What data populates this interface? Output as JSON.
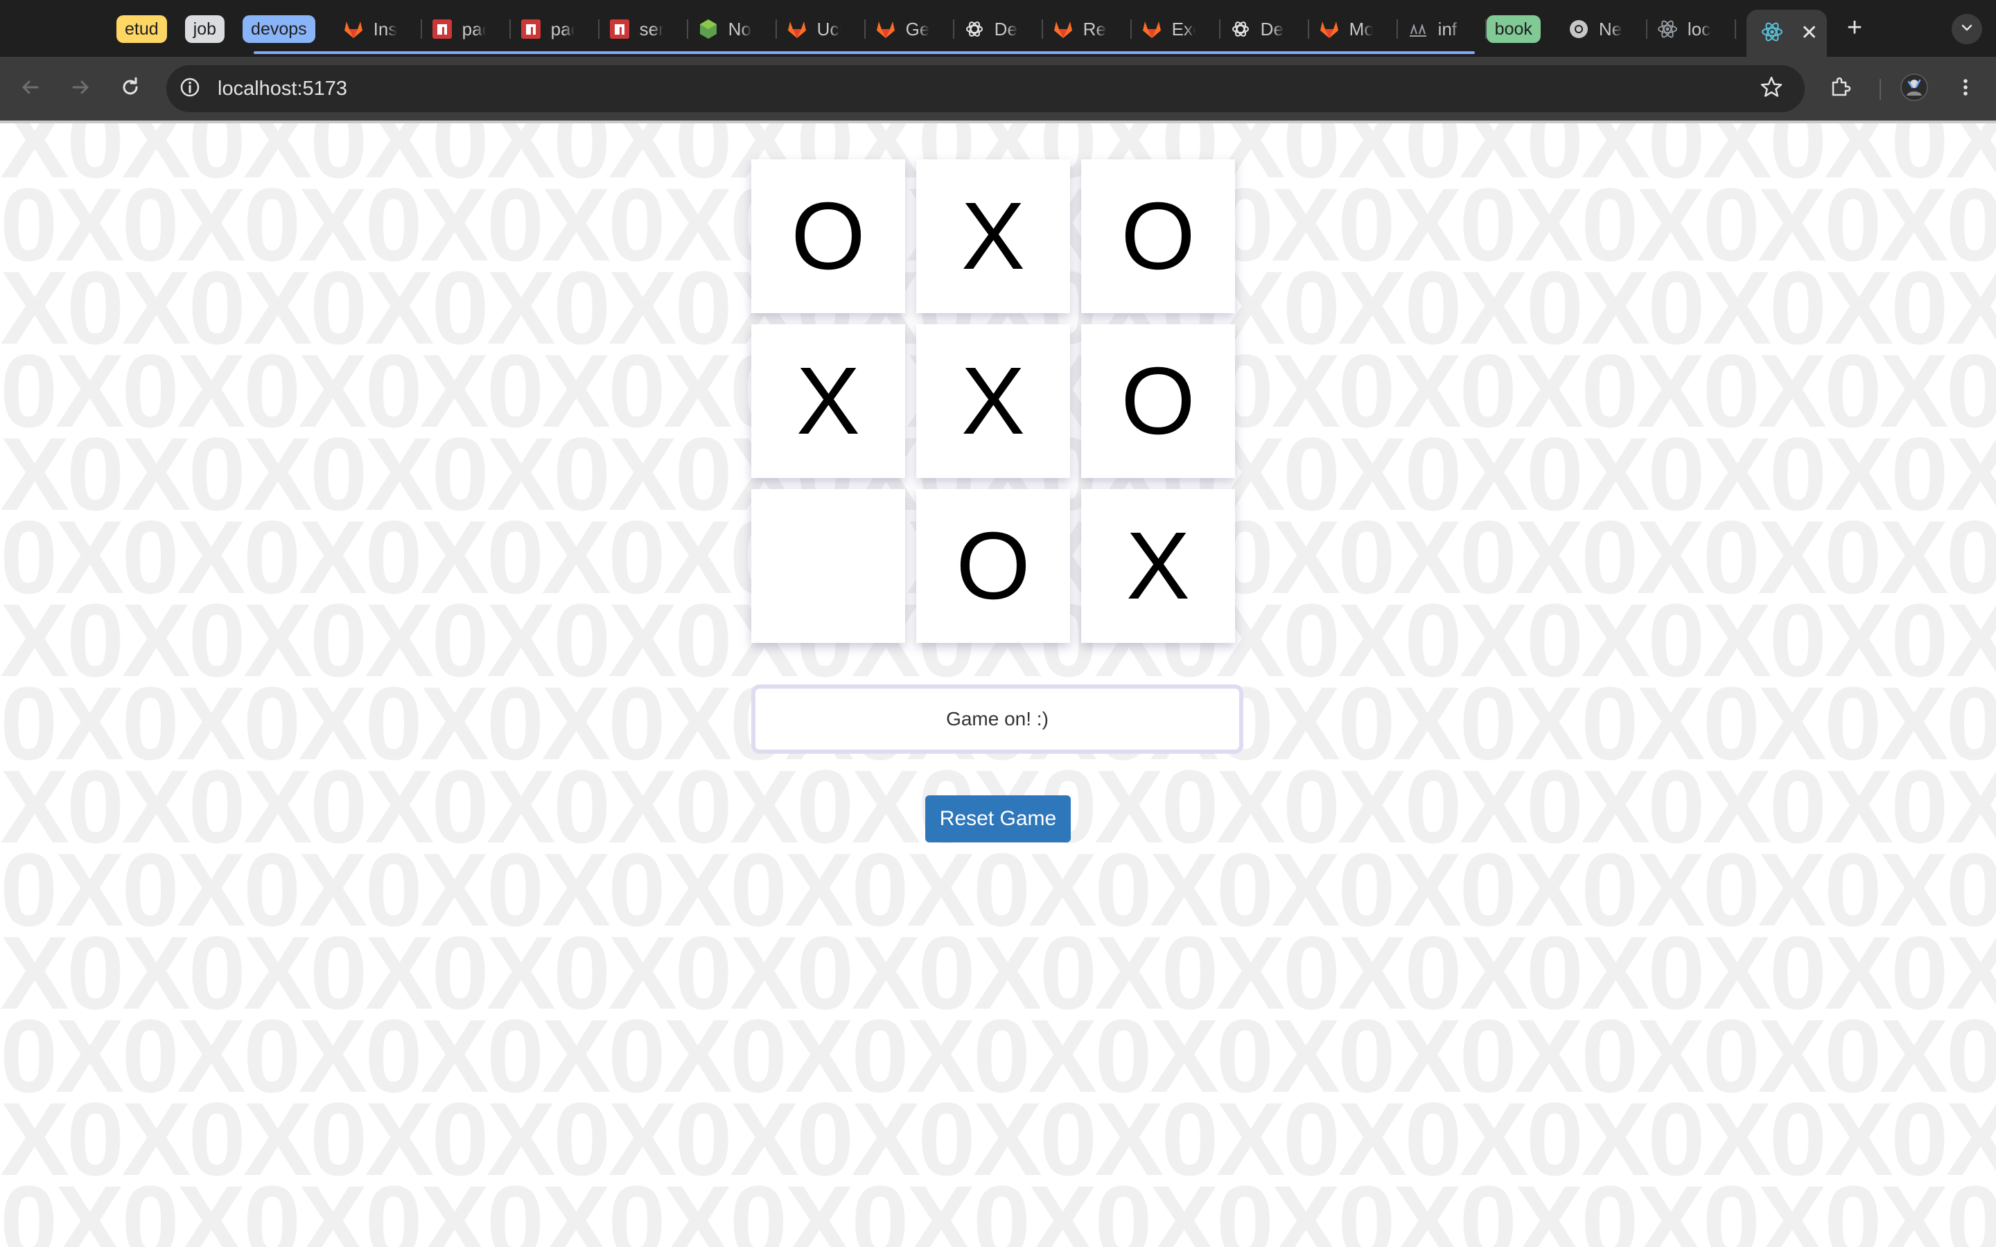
{
  "browser": {
    "tab_groups": [
      {
        "label": "etud",
        "color": "#fdd663"
      },
      {
        "label": "job",
        "color": "#dadce0"
      },
      {
        "label": "devops",
        "color": "#8ab4f8"
      }
    ],
    "tabs": [
      {
        "title": "Ins",
        "icon": "gitlab-icon"
      },
      {
        "title": "pac",
        "icon": "npm-icon"
      },
      {
        "title": "pac",
        "icon": "npm-icon"
      },
      {
        "title": "ser",
        "icon": "npm-icon"
      },
      {
        "title": "No",
        "icon": "nodejs-icon"
      },
      {
        "title": "Ucl",
        "icon": "gitlab-icon"
      },
      {
        "title": "Ge",
        "icon": "gitlab-icon"
      },
      {
        "title": "De",
        "icon": "openai-icon"
      },
      {
        "title": "Re",
        "icon": "gitlab-icon"
      },
      {
        "title": "Exe",
        "icon": "gitlab-icon"
      },
      {
        "title": "De",
        "icon": "openai-icon"
      },
      {
        "title": "Mo",
        "icon": "gitlab-icon"
      },
      {
        "title": "inf",
        "icon": "site-icon"
      }
    ],
    "book_group": {
      "label": "book",
      "color": "#81c995"
    },
    "tabs_after_book": [
      {
        "title": "Ne",
        "icon": "chrome-icon"
      },
      {
        "title": "loc",
        "icon": "react-icon"
      }
    ],
    "active_tab": {
      "icon": "react-icon",
      "close_label": "✕"
    },
    "new_tab_label": "+",
    "url": "localhost:5173"
  },
  "game": {
    "board": [
      "O",
      "X",
      "O",
      "X",
      "X",
      "O",
      "",
      "O",
      "X"
    ],
    "status": "Game on! :)",
    "reset_label": "Reset Game"
  },
  "background": {
    "pattern_a": "X0X0X0X0X0X0X0X0X0X0X0X0X0X0X0X0X0X0",
    "pattern_b": "0X0X0X0X0X0X0X0X0X0X0X0X0X0X0X0X0X0X"
  }
}
